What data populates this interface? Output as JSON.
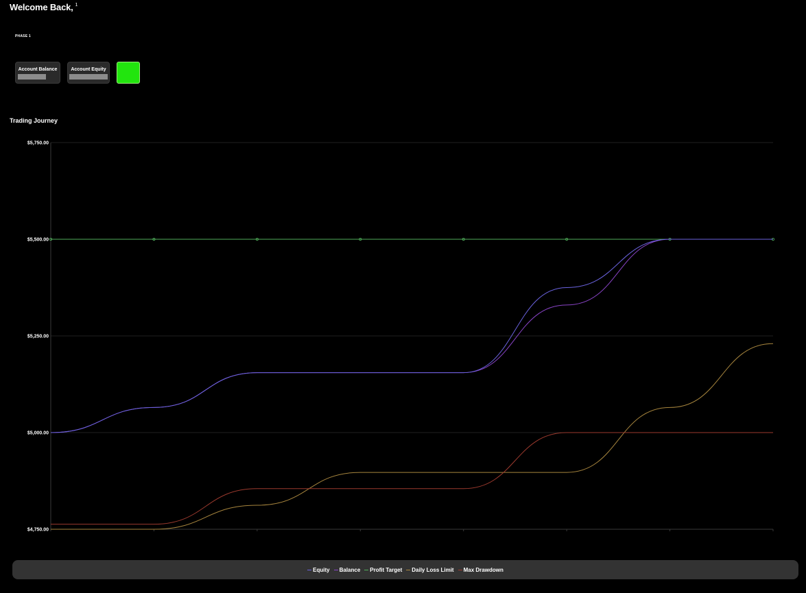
{
  "header": {
    "welcome": "Welcome Back,",
    "welcome_sup": "1",
    "phase": "PHASE 1"
  },
  "cards": {
    "balance_label": "Account Balance",
    "equity_label": "Account Equity",
    "status_color": "#22e50e"
  },
  "section_title": "Trading Journey",
  "chart_data": {
    "type": "line",
    "ylim": [
      4750,
      5750
    ],
    "yticks": [
      4750,
      5000,
      5250,
      5500,
      5750
    ],
    "ytick_labels": [
      "$4,750.00",
      "$5,000.00",
      "$5,250.00",
      "$5,500.00",
      "$5,750.00"
    ],
    "x": [
      0,
      1,
      2,
      3,
      4,
      5,
      6,
      7
    ],
    "xtick_labels": [
      "",
      "",
      "",
      "",
      "",
      "",
      "",
      ""
    ],
    "series": [
      {
        "name": "Equity",
        "color": "#6b63e0",
        "values": [
          5000,
          5065,
          5155,
          5155,
          5155,
          5375,
          5500,
          5500
        ]
      },
      {
        "name": "Balance",
        "color": "#8a44c8",
        "values": [
          5000,
          5065,
          5155,
          5155,
          5155,
          5330,
          5500,
          5500
        ]
      },
      {
        "name": "Profit Target",
        "color": "#4fae5a",
        "values": [
          5500,
          5500,
          5500,
          5500,
          5500,
          5500,
          5500,
          5500
        ],
        "markers": true
      },
      {
        "name": "Daily Loss Limit",
        "color": "#a8863e",
        "values": [
          4750,
          4750,
          4812,
          4897,
          4897,
          4897,
          5065,
          5230
        ]
      },
      {
        "name": "Max Drawdown",
        "color": "#9c3a2e",
        "values": [
          4763,
          4763,
          4855,
          4855,
          4855,
          5000,
          5000,
          5000
        ]
      }
    ],
    "grid": true,
    "legend": "bottom"
  }
}
